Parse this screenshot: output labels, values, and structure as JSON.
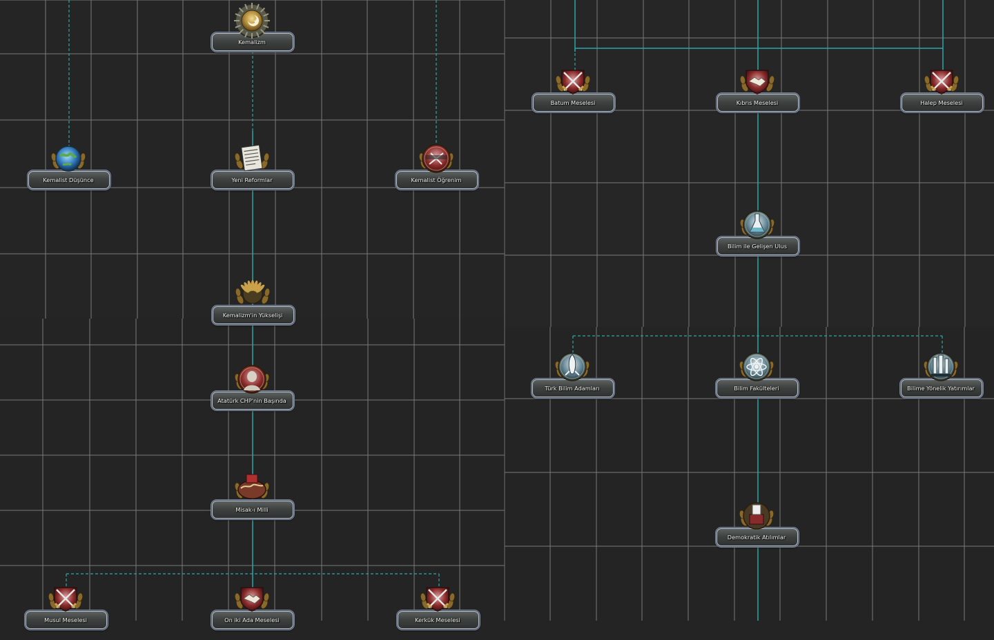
{
  "screen": "Focus Tree",
  "colors": {
    "background": "#242424",
    "grid": "#7a7a7a",
    "connector": "#2aa7a7"
  },
  "focuses": [
    {
      "id": "kemalizm",
      "label": "Kemalizm",
      "icon": "star-crescent-icon"
    },
    {
      "id": "kemalist-dusunce",
      "label": "Kemalist Düşünce",
      "icon": "globe-icon"
    },
    {
      "id": "yeni-reformlar",
      "label": "Yeni Reformlar",
      "icon": "newspaper-icon"
    },
    {
      "id": "kemalist-ogrenim",
      "label": "Kemalist Öğrenim",
      "icon": "education-icon"
    },
    {
      "id": "kemalizmin-yukselisi",
      "label": "Kemalizm'in Yükselişi",
      "icon": "laurel-icon"
    },
    {
      "id": "ataturk-chp",
      "label": "Atatürk CHP'nin Başında",
      "icon": "leader-portrait-icon"
    },
    {
      "id": "misak-i-milli",
      "label": "Misak-ı Milli",
      "icon": "map-icon"
    },
    {
      "id": "musul-meselesi",
      "label": "Musul Meselesi",
      "icon": "crossed-swords-icon"
    },
    {
      "id": "on-iki-ada",
      "label": "On iki Ada Meselesi",
      "icon": "handshake-icon"
    },
    {
      "id": "kerkuk-meselesi",
      "label": "Kerkük Meselesi",
      "icon": "crossed-swords-icon"
    },
    {
      "id": "batum-meselesi",
      "label": "Batum Meselesi",
      "icon": "crossed-swords-icon"
    },
    {
      "id": "kibris-meselesi",
      "label": "Kıbrıs Meselesi",
      "icon": "handshake-icon"
    },
    {
      "id": "halep-meselesi",
      "label": "Halep Meselesi",
      "icon": "crossed-swords-icon"
    },
    {
      "id": "bilim-gelisen-ulus",
      "label": "Bilim ile Gelişen Ulus",
      "icon": "flask-icon"
    },
    {
      "id": "turk-bilim-adamlari",
      "label": "Türk Bilim Adamları",
      "icon": "rocket-icon"
    },
    {
      "id": "bilim-fakulteleri",
      "label": "Bilim Fakülteleri",
      "icon": "atom-icon"
    },
    {
      "id": "bilime-yonelik-yatirimlar",
      "label": "Bilime Yönelik Yatırımlar",
      "icon": "lab-equipment-icon"
    },
    {
      "id": "demokratik-atilimlar",
      "label": "Demokratik Atılımlar",
      "icon": "ballot-icon"
    }
  ]
}
